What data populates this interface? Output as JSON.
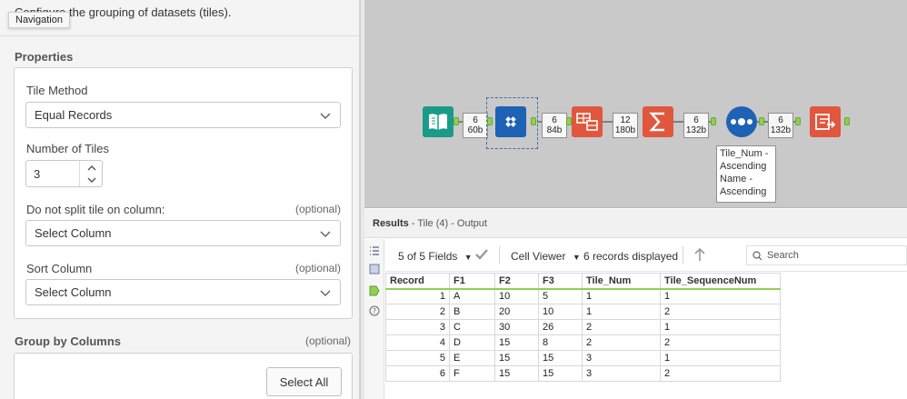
{
  "config": {
    "description": "Configure the grouping of datasets (tiles).",
    "tooltip": "Navigation",
    "properties_heading": "Properties",
    "tile_method": {
      "label": "Tile Method",
      "value": "Equal Records"
    },
    "number_of_tiles": {
      "label": "Number of Tiles",
      "value": "3"
    },
    "no_split": {
      "label": "Do not split tile on column:",
      "optional": "(optional)",
      "value": "Select Column"
    },
    "sort_column": {
      "label": "Sort Column",
      "optional": "(optional)",
      "value": "Select Column"
    },
    "group_by": {
      "heading": "Group by Columns",
      "optional": "(optional)",
      "select_all": "Select All"
    }
  },
  "workflow": {
    "badges": [
      {
        "count": "6",
        "size": "60b"
      },
      {
        "count": "6",
        "size": "84b"
      },
      {
        "count": "12",
        "size": "180b"
      },
      {
        "count": "6",
        "size": "132b"
      },
      {
        "count": "6",
        "size": "132b"
      }
    ],
    "annotation": [
      "Tile_Num -",
      "Ascending",
      "Name -",
      "Ascending"
    ],
    "tool_icons": [
      "input-data-icon",
      "tile-icon",
      "transpose-icon",
      "summarize-icon",
      "sort-icon",
      "output-icon"
    ],
    "colors": {
      "input": "#1a9b8a",
      "tile": "#1d62b5",
      "transform": "#e0573d",
      "canvas": "#c9c9c9",
      "anchor": "#8fd14f"
    }
  },
  "results": {
    "title": "Results",
    "subtitle": " - Tile (4) - Output",
    "toolbar": {
      "fields": "5 of 5 Fields",
      "viewer": "Cell Viewer",
      "records": "6 records displayed",
      "search_placeholder": "Search"
    },
    "columns": [
      "Record",
      "F1",
      "F2",
      "F3",
      "Tile_Num",
      "Tile_SequenceNum"
    ],
    "rows": [
      [
        "1",
        "A",
        "10",
        "5",
        "1",
        "1"
      ],
      [
        "2",
        "B",
        "20",
        "10",
        "1",
        "2"
      ],
      [
        "3",
        "C",
        "30",
        "26",
        "2",
        "1"
      ],
      [
        "4",
        "D",
        "15",
        "8",
        "2",
        "2"
      ],
      [
        "5",
        "E",
        "15",
        "15",
        "3",
        "1"
      ],
      [
        "6",
        "F",
        "15",
        "15",
        "3",
        "2"
      ]
    ]
  }
}
